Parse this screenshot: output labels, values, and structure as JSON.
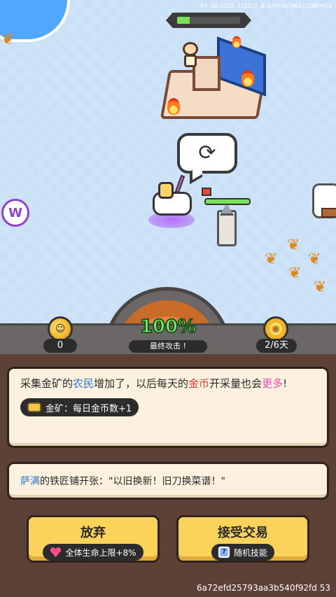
{
  "debug_overlay": "05-16:1217,1152|2.0.634|461861|25963421",
  "map": {
    "boss_hp_fraction": 0.2,
    "ally_hp_fraction": 1.0,
    "bubble_icon": "refresh-icon",
    "portal_letter": "W"
  },
  "hud": {
    "coins": "0",
    "attack_percent": "100%",
    "attack_label": "最终攻击 !",
    "day_counter": "2/6天"
  },
  "event": {
    "main_text_parts": [
      {
        "text": "采集金矿的",
        "style": ""
      },
      {
        "text": "农民",
        "style": "blue"
      },
      {
        "text": "增加了，以后每天的",
        "style": ""
      },
      {
        "text": "金币",
        "style": "red"
      },
      {
        "text": "开采量也会",
        "style": ""
      },
      {
        "text": "更多",
        "style": "pink"
      },
      {
        "text": "!",
        "style": ""
      }
    ],
    "reward_tag": "金矿：每日金币数+1",
    "story_name": "萨满",
    "story_text": "的铁匠铺开张：\"以旧换新！旧刀换菜谱！\""
  },
  "buttons": {
    "reject_label": "放弃",
    "reject_tag": "全体生命上限+8%",
    "accept_label": "接受交易",
    "accept_tag": "随机技能"
  },
  "footer_hash": "6a72efd25793aa3b540f92fd 53",
  "colors": {
    "panel_bg": "#5d4036",
    "card_bg": "#fbf1de",
    "button_bg": "#fbd35b",
    "highlight_blue": "#2a77d6",
    "highlight_red": "#e53b37",
    "highlight_pink": "#e94bb5"
  }
}
